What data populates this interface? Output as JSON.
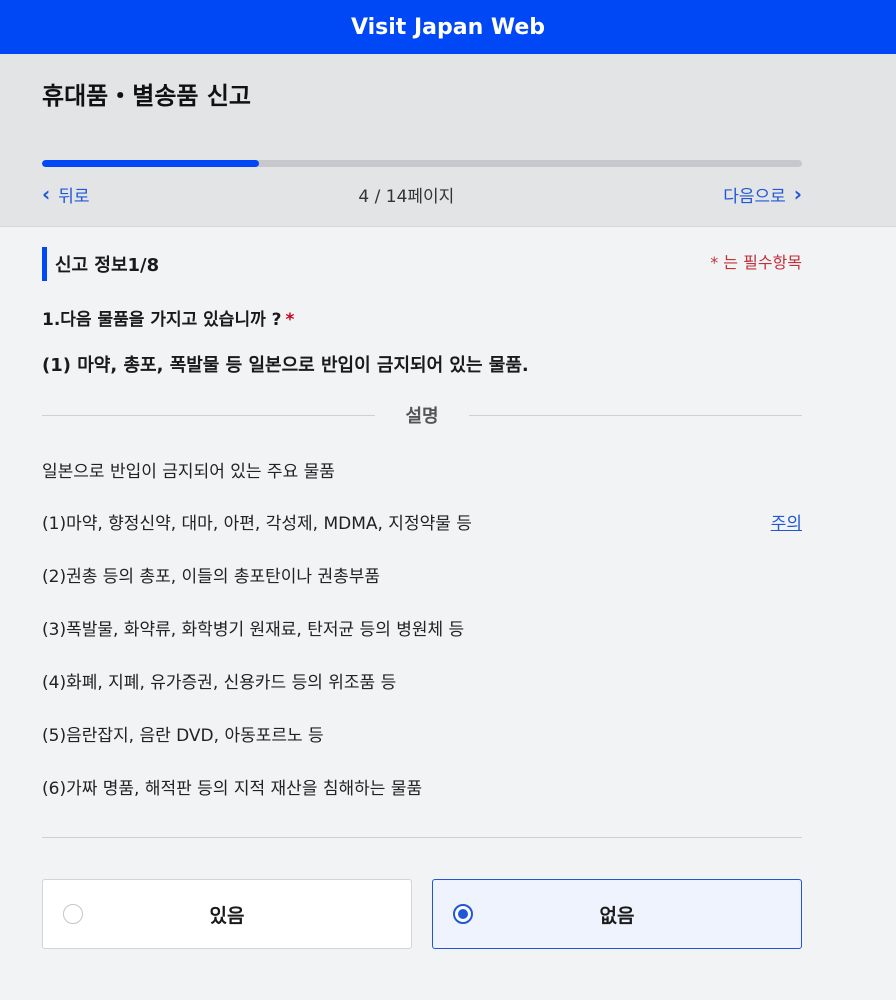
{
  "app": {
    "title": "Visit Japan Web"
  },
  "header": {
    "page_title": "휴대품・별송품 신고",
    "progress": {
      "current": 4,
      "total": 14,
      "fraction": 0.2857
    },
    "back_label": "뒤로",
    "page_indicator": "4 / 14페이지",
    "next_label": "다음으로"
  },
  "section": {
    "title": "신고 정보1/8",
    "required_note": "* 는 필수항목"
  },
  "question": {
    "text": "1.다음 물품을 가지고 있습니까 ?",
    "required_mark": "*",
    "sub": "(1) 마약, 총포, 폭발물 등 일본으로 반입이 금지되어 있는 물품."
  },
  "explanation": {
    "label": "설명",
    "intro": "일본으로 반입이 금지되어 있는 주요 물품",
    "items": [
      "(1)마약, 향정신약, 대마, 아편, 각성제, MDMA, 지정약물 등",
      "(2)권총 등의 총포, 이들의 총포탄이나 권총부품",
      "(3)폭발물, 화약류, 화학병기 원재료, 탄저균 등의 병원체 등",
      "(4)화폐, 지폐, 유가증권, 신용카드 등의 위조품 등",
      "(5)음란잡지, 음란 DVD, 아동포르노 등",
      "(6)가짜 명품, 해적판 등의 지적 재산을 침해하는 물품"
    ],
    "caution_link": "주의"
  },
  "options": {
    "yes": {
      "label": "있음",
      "selected": false
    },
    "no": {
      "label": "없음",
      "selected": true
    }
  },
  "colors": {
    "brand": "#0048f5",
    "link": "#1f57d6",
    "required": "#c2303a"
  }
}
